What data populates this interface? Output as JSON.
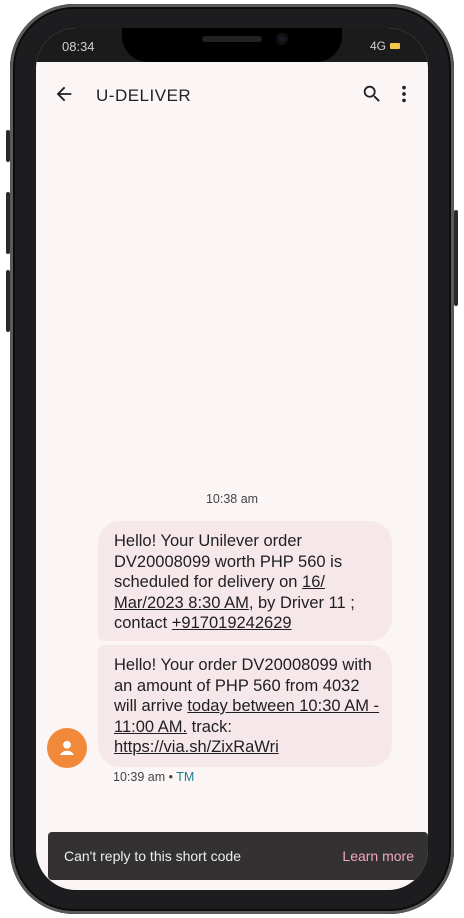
{
  "status_bar": {
    "time": "08:34",
    "network": "4G"
  },
  "app_bar": {
    "back_icon": "arrow-left-icon",
    "title": "U-DELIVER",
    "search_icon": "search-icon",
    "more_icon": "more-vertical-icon"
  },
  "conversation": {
    "date_time": "10:38 am",
    "messages": [
      {
        "parts": [
          "Hello! Your Unilever order DV20008099 worth PHP 560 is scheduled for delivery on ",
          "16/ Mar/2023 8:30 AM",
          ", by Driver 11 ; contact ",
          "+917019242629"
        ]
      },
      {
        "parts": [
          "Hello! Your order DV20008099 with an amount of PHP 560 from 4032 will arrive ",
          "today between 10:30 AM - 11:00 AM.",
          " track: ",
          "https://via.sh/ZixRaWri"
        ]
      }
    ],
    "meta_time": "10:39 am",
    "meta_separator": " • ",
    "meta_sim": "TM",
    "avatar_icon": "person-icon",
    "avatar_color": "#f08a3a"
  },
  "snackbar": {
    "message": "Can't reply to this short code",
    "action": "Learn more"
  },
  "colors": {
    "bubble": "#f6e8ea",
    "background": "#fcf5f5",
    "snackbar": "#343132",
    "action_text": "#f2a6c4"
  }
}
